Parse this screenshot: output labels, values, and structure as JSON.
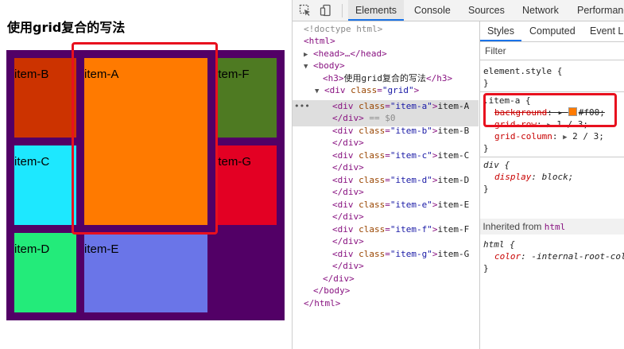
{
  "page": {
    "title": "使用grid复合的写法",
    "items": [
      {
        "key": "item_b",
        "label": "item-B",
        "color": "#cc3300"
      },
      {
        "key": "item_a",
        "label": "item-A",
        "color": "#ff7a00"
      },
      {
        "key": "item_f",
        "label": "item-F",
        "color": "#4e7a22"
      },
      {
        "key": "item_c",
        "label": "item-C",
        "color": "#1de8ff"
      },
      {
        "key": "item_g",
        "label": "item-G",
        "color": "#e30023"
      },
      {
        "key": "item_d",
        "label": "item-D",
        "color": "#23eb7a"
      },
      {
        "key": "item_e",
        "label": "item-E",
        "color": "#6a75e8"
      }
    ],
    "grid_bg": "#520066"
  },
  "devtools": {
    "tabs": [
      "Elements",
      "Console",
      "Sources",
      "Network",
      "Performance"
    ],
    "active_tab": "Elements",
    "dom": {
      "doctype": "<!doctype html>",
      "html_open": "<html>",
      "head": "<head>…</head>",
      "body_open": "<body>",
      "h3_text": "使用grid复合的写法",
      "div_grid_class": "grid",
      "children": [
        {
          "class": "item-a",
          "text": "item-A",
          "selected_suffix": "== $0"
        },
        {
          "class": "item-b",
          "text": "item-B"
        },
        {
          "class": "item-c",
          "text": "item-C"
        },
        {
          "class": "item-d",
          "text": "item-D"
        },
        {
          "class": "item-e",
          "text": "item-E"
        },
        {
          "class": "item-f",
          "text": "item-F"
        },
        {
          "class": "item-g",
          "text": "item-G"
        }
      ],
      "div_close": "</div>",
      "body_close": "</body>",
      "html_close": "</html>"
    },
    "styles": {
      "subtabs": [
        "Styles",
        "Computed",
        "Event Listeners"
      ],
      "active_subtab": "Styles",
      "filter_placeholder": "Filter",
      "element_style": "element.style {",
      "close_brace": "}",
      "rule1_selector": ".item-a {",
      "rule1_props": [
        {
          "name": "background",
          "value": "#f00;",
          "struck": true
        },
        {
          "name": "grid-row",
          "value": "1 / 3;"
        },
        {
          "name": "grid-column",
          "value": "2 / 3;"
        }
      ],
      "rule2_selector": "div {",
      "rule2_prop": {
        "name": "display",
        "value": "block;"
      },
      "inherited_label": "Inherited from",
      "inherited_from": "html",
      "rule3_selector": "html {",
      "rule3_prop": {
        "name": "color",
        "value": "-internal-root-color;"
      }
    }
  }
}
